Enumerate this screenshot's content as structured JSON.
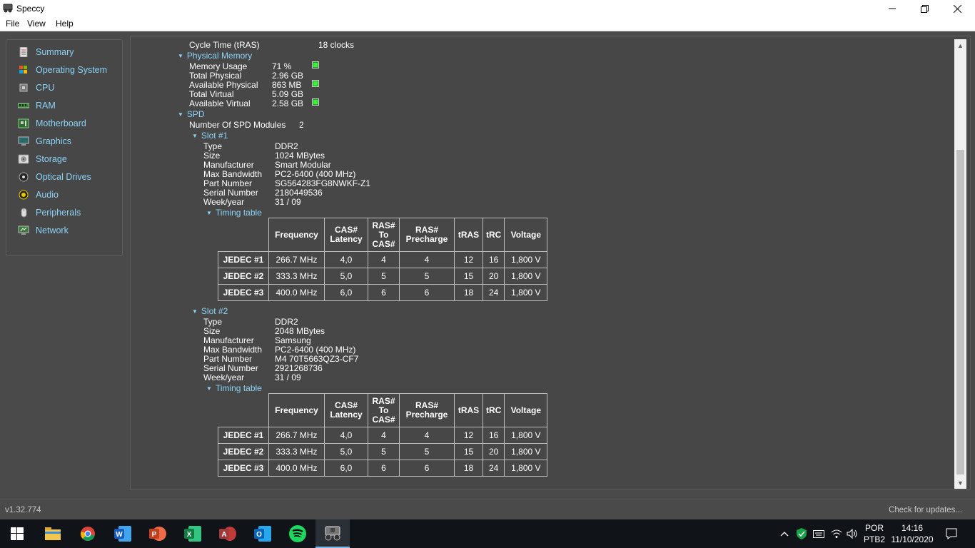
{
  "window": {
    "title": "Speccy"
  },
  "menu": [
    "File",
    "View",
    "Help"
  ],
  "sidebar": {
    "items": [
      {
        "label": "Summary",
        "icon": "summary-icon"
      },
      {
        "label": "Operating System",
        "icon": "windows-icon"
      },
      {
        "label": "CPU",
        "icon": "cpu-icon"
      },
      {
        "label": "RAM",
        "icon": "ram-icon"
      },
      {
        "label": "Motherboard",
        "icon": "motherboard-icon"
      },
      {
        "label": "Graphics",
        "icon": "monitor-icon"
      },
      {
        "label": "Storage",
        "icon": "storage-icon"
      },
      {
        "label": "Optical Drives",
        "icon": "optical-drive-icon"
      },
      {
        "label": "Audio",
        "icon": "speaker-icon"
      },
      {
        "label": "Peripherals",
        "icon": "mouse-icon"
      },
      {
        "label": "Network",
        "icon": "network-icon"
      }
    ]
  },
  "content": {
    "cycle_time": {
      "label": "Cycle Time (tRAS)",
      "value": "18 clocks"
    },
    "physical_memory": {
      "heading": "Physical Memory",
      "rows": [
        {
          "label": "Memory Usage",
          "value": "71 %"
        },
        {
          "label": "Total Physical",
          "value": "2.96 GB"
        },
        {
          "label": "Available Physical",
          "value": "863 MB"
        },
        {
          "label": "Total Virtual",
          "value": "5.09 GB"
        },
        {
          "label": "Available Virtual",
          "value": "2.58 GB"
        }
      ]
    },
    "spd": {
      "heading": "SPD",
      "modules_label": "Number Of SPD Modules",
      "modules_value": "2",
      "timing_heading": "Timing table",
      "table_headers": [
        "Frequency",
        "CAS# Latency",
        "RAS# To CAS#",
        "RAS# Precharge",
        "tRAS",
        "tRC",
        "Voltage"
      ],
      "slots": [
        {
          "heading": "Slot #1",
          "rows": [
            {
              "label": "Type",
              "value": "DDR2"
            },
            {
              "label": "Size",
              "value": "1024 MBytes"
            },
            {
              "label": "Manufacturer",
              "value": "Smart Modular"
            },
            {
              "label": "Max Bandwidth",
              "value": "PC2-6400 (400 MHz)"
            },
            {
              "label": "Part Number",
              "value": "SG564283FG8NWKF-Z1"
            },
            {
              "label": "Serial Number",
              "value": "2180449536"
            },
            {
              "label": "Week/year",
              "value": "31 / 09"
            }
          ],
          "timings": [
            [
              "JEDEC #1",
              "266.7 MHz",
              "4,0",
              "4",
              "4",
              "12",
              "16",
              "1,800 V"
            ],
            [
              "JEDEC #2",
              "333.3 MHz",
              "5,0",
              "5",
              "5",
              "15",
              "20",
              "1,800 V"
            ],
            [
              "JEDEC #3",
              "400.0 MHz",
              "6,0",
              "6",
              "6",
              "18",
              "24",
              "1,800 V"
            ]
          ]
        },
        {
          "heading": "Slot #2",
          "rows": [
            {
              "label": "Type",
              "value": "DDR2"
            },
            {
              "label": "Size",
              "value": "2048 MBytes"
            },
            {
              "label": "Manufacturer",
              "value": "Samsung"
            },
            {
              "label": "Max Bandwidth",
              "value": "PC2-6400 (400 MHz)"
            },
            {
              "label": "Part Number",
              "value": "M4 70T5663QZ3-CF7"
            },
            {
              "label": "Serial Number",
              "value": "2921268736"
            },
            {
              "label": "Week/year",
              "value": "31 / 09"
            }
          ],
          "timings": [
            [
              "JEDEC #1",
              "266.7 MHz",
              "4,0",
              "4",
              "4",
              "12",
              "16",
              "1,800 V"
            ],
            [
              "JEDEC #2",
              "333.3 MHz",
              "5,0",
              "5",
              "5",
              "15",
              "20",
              "1,800 V"
            ],
            [
              "JEDEC #3",
              "400.0 MHz",
              "6,0",
              "6",
              "6",
              "18",
              "24",
              "1,800 V"
            ]
          ]
        }
      ]
    }
  },
  "status": {
    "version": "v1.32.774",
    "updates": "Check for updates..."
  },
  "taskbar": {
    "language": "POR",
    "layout": "PTB2",
    "time": "14:16",
    "date": "11/10/2020"
  },
  "colors": {
    "accent": "#8bd3f7",
    "background": "#4a4a4a",
    "usage_bar": "#3ff03f"
  }
}
